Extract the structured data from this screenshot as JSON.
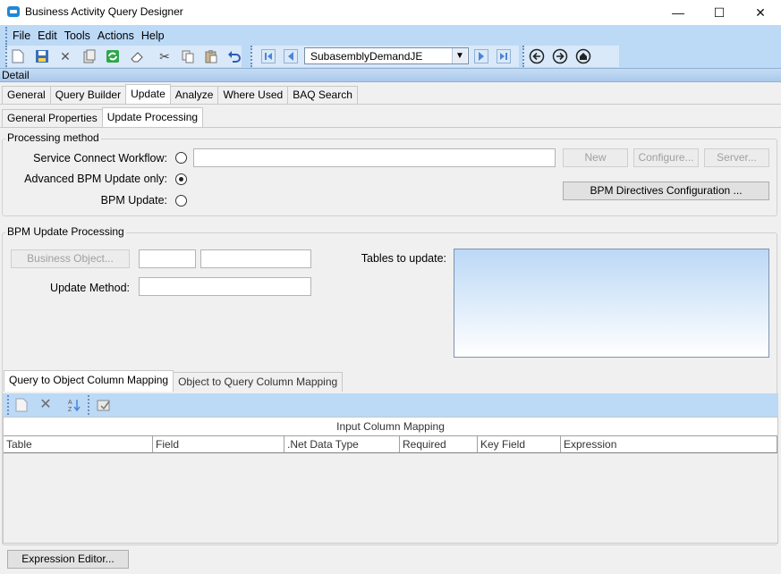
{
  "window": {
    "title": "Business Activity Query Designer",
    "minimize": "—",
    "maximize": "☐",
    "close": "✕"
  },
  "menu": [
    "File",
    "Edit",
    "Tools",
    "Actions",
    "Help"
  ],
  "toolbar": {
    "query_id": "SubasemblyDemandJE"
  },
  "detail_bar": "Detail",
  "main_tabs": [
    "General",
    "Query Builder",
    "Update",
    "Analyze",
    "Where Used",
    "BAQ Search"
  ],
  "main_active_tab": "Update",
  "sub_tabs": [
    "General Properties",
    "Update  Processing"
  ],
  "sub_active_tab": "Update  Processing",
  "processing_method": {
    "title": "Processing method",
    "service_connect_label": "Service Connect Workflow:",
    "service_connect_value": "",
    "advanced_bpm_label": "Advanced BPM Update only:",
    "bpm_update_label": "BPM Update:",
    "selected": "advanced_bpm",
    "new_label": "New",
    "configure_label": "Configure...",
    "server_label": "Server...",
    "bpm_directives_label": "BPM Directives Configuration ..."
  },
  "bpm_update": {
    "title": "BPM Update Processing",
    "business_object_label": "Business Object...",
    "business_object_value1": "",
    "business_object_value2": "",
    "update_method_label": "Update Method:",
    "update_method_value": "",
    "tables_label": "Tables to update:"
  },
  "mapping_tabs": [
    "Query to Object Column Mapping",
    "Object to Query Column Mapping"
  ],
  "mapping_active_tab": "Query to Object Column Mapping",
  "grid": {
    "band": "Input Column Mapping",
    "columns": [
      "Table",
      "Field",
      ".Net Data Type",
      "Required",
      "Key Field",
      "Expression"
    ]
  },
  "expression_editor_label": "Expression Editor..."
}
